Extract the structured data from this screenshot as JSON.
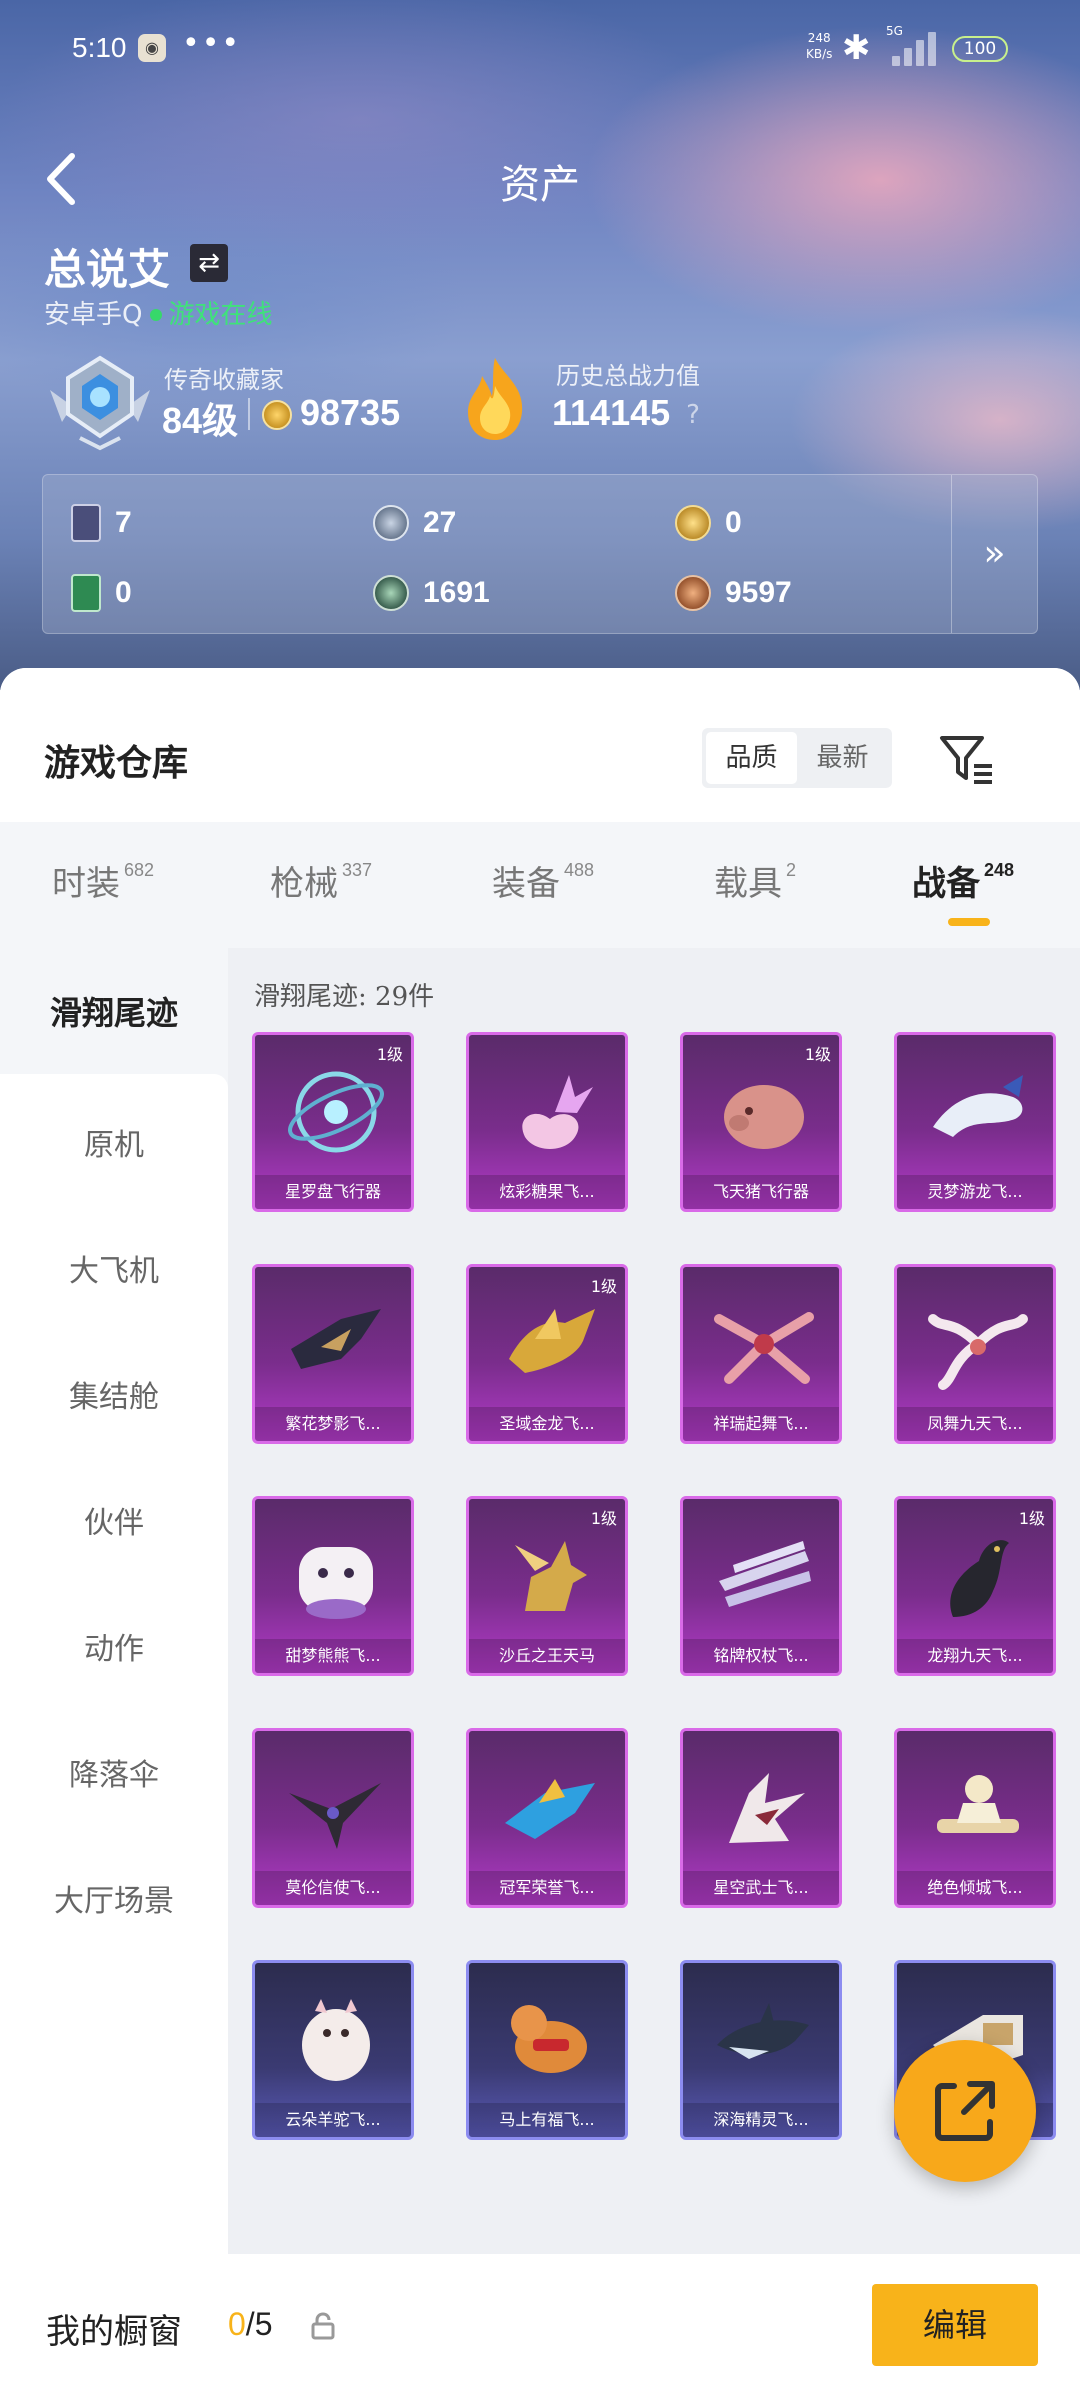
{
  "status_bar": {
    "time": "5:10",
    "net_speed_top": "248",
    "net_speed_bottom": "KB/s",
    "network": "5G",
    "battery": "100"
  },
  "header": {
    "title": "资产"
  },
  "player": {
    "name": "总说艾",
    "account": "安卓手Q",
    "status": "游戏在线",
    "collector_label": "传奇收藏家",
    "collector_level": "84级",
    "coins": "98735",
    "power_label": "历史总战力值",
    "power_value": "114145",
    "help": "?"
  },
  "currencies": [
    {
      "value": "7",
      "icon": "card-icon",
      "color": "#4a4e7a"
    },
    {
      "value": "27",
      "icon": "silver-coin-icon",
      "color": "#7e90a8"
    },
    {
      "value": "0",
      "icon": "gold-coin-icon",
      "color": "#c99a2e"
    },
    {
      "value": "0",
      "icon": "green-card-icon",
      "color": "#2e8a52"
    },
    {
      "value": "1691",
      "icon": "green-orb-icon",
      "color": "#3a6a56"
    },
    {
      "value": "9597",
      "icon": "bronze-coin-icon",
      "color": "#b7693a"
    }
  ],
  "currency_more": "»",
  "warehouse": {
    "title": "游戏仓库",
    "sort_options": [
      "品质",
      "最新"
    ],
    "sort_active": 0
  },
  "tabs": [
    {
      "label": "时装",
      "count": "682"
    },
    {
      "label": "枪械",
      "count": "337"
    },
    {
      "label": "装备",
      "count": "488"
    },
    {
      "label": "载具",
      "count": "2"
    },
    {
      "label": "战备",
      "count": "248"
    }
  ],
  "side_nav": [
    "滑翔尾迹",
    "原机",
    "大飞机",
    "集结舱",
    "伙伴",
    "动作",
    "降落伞",
    "大厅场景"
  ],
  "grid_label": "滑翔尾迹: 29件",
  "items": [
    {
      "name": "星罗盘飞行器",
      "level": "1级",
      "art": "orbit-compass"
    },
    {
      "name": "炫彩糖果飞...",
      "level": "",
      "art": "candy-flower"
    },
    {
      "name": "飞天猪飞行器",
      "level": "1级",
      "art": "flying-pig"
    },
    {
      "name": "灵梦游龙飞...",
      "level": "",
      "art": "white-dragon"
    },
    {
      "name": "繁花梦影飞...",
      "level": "",
      "art": "dark-dragon"
    },
    {
      "name": "圣域金龙飞...",
      "level": "1级",
      "art": "gold-dragon"
    },
    {
      "name": "祥瑞起舞飞...",
      "level": "",
      "art": "phoenix-red"
    },
    {
      "name": "凤舞九天飞...",
      "level": "",
      "art": "phoenix-white"
    },
    {
      "name": "甜梦熊熊飞...",
      "level": "",
      "art": "dream-bear"
    },
    {
      "name": "沙丘之王天马",
      "level": "1级",
      "art": "golden-pegasus"
    },
    {
      "name": "铭牌权杖飞...",
      "level": "",
      "art": "crystal-blades"
    },
    {
      "name": "龙翔九天飞...",
      "level": "1级",
      "art": "black-dragon"
    },
    {
      "name": "莫伦信使飞...",
      "level": "",
      "art": "dark-bird"
    },
    {
      "name": "冠军荣誉飞...",
      "level": "",
      "art": "blue-jet"
    },
    {
      "name": "星空武士飞...",
      "level": "",
      "art": "white-wing"
    },
    {
      "name": "绝色倾城飞...",
      "level": "",
      "art": "fairy-bench"
    },
    {
      "name": "云朵羊驼飞...",
      "level": "",
      "art": "alpaca"
    },
    {
      "name": "马上有福飞...",
      "level": "",
      "art": "toy-horse"
    },
    {
      "name": "深海精灵飞...",
      "level": "",
      "art": "shark"
    },
    {
      "name": "",
      "level": "",
      "art": "white-pod"
    }
  ],
  "bottom": {
    "showcase_label": "我的橱窗",
    "showcase_current": "0",
    "showcase_total": "/5",
    "edit_label": "编辑"
  },
  "colors": {
    "accent": "#f8b31a",
    "legendary_border": "#d96ae8",
    "epic_border": "#8c8cf0",
    "online": "#37d86a"
  }
}
